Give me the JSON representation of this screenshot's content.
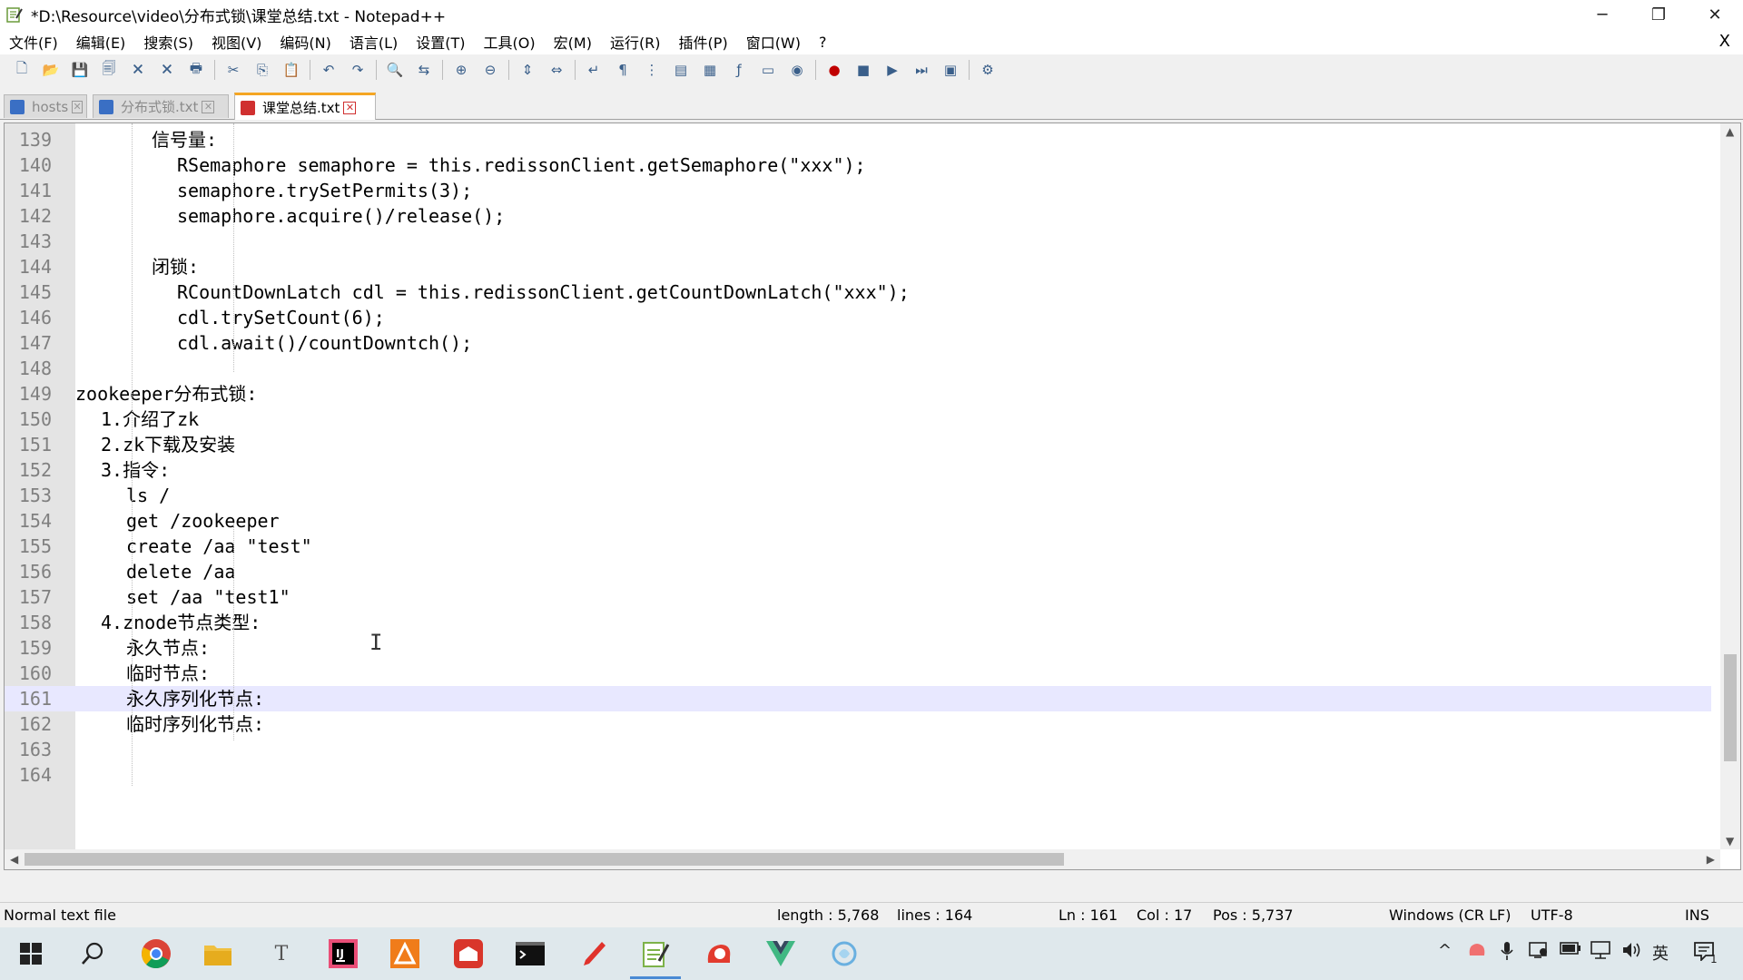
{
  "window": {
    "title": "*D:\\Resource\\video\\分布式锁\\课堂总结.txt - Notepad++",
    "controls": {
      "minimize": "─",
      "maximize": "❐",
      "close": "✕"
    }
  },
  "menu": {
    "items": [
      "文件(F)",
      "编辑(E)",
      "搜索(S)",
      "视图(V)",
      "编码(N)",
      "语言(L)",
      "设置(T)",
      "工具(O)",
      "宏(M)",
      "运行(R)",
      "插件(P)",
      "窗口(W)",
      "?"
    ],
    "close": "X"
  },
  "toolbar": {
    "icons": [
      "new-file-icon",
      "open-file-icon",
      "save-icon",
      "save-all-icon",
      "close-icon",
      "close-all-icon",
      "print-icon",
      "cut-icon",
      "copy-icon",
      "paste-icon",
      "undo-icon",
      "redo-icon",
      "find-icon",
      "replace-icon",
      "zoom-in-icon",
      "zoom-out-icon",
      "sync-vertical-icon",
      "sync-horizontal-icon",
      "word-wrap-icon",
      "show-all-chars-icon",
      "indent-guide-icon",
      "udl-icon",
      "doc-map-icon",
      "function-list-icon",
      "folder-workspace-icon",
      "monitor-icon",
      "record-macro-icon",
      "stop-macro-icon",
      "play-macro-icon",
      "run-macro-multiple-icon",
      "save-macro-icon",
      "plugin-icon"
    ]
  },
  "tabs": [
    {
      "label": "hosts",
      "active": false,
      "color": "#3a6fc4"
    },
    {
      "label": "分布式锁.txt",
      "active": false,
      "color": "#3a6fc4"
    },
    {
      "label": "课堂总结.txt",
      "active": true,
      "color": "#d03030"
    }
  ],
  "editor": {
    "current_line": 161,
    "lines": [
      {
        "n": "139",
        "indent": 6,
        "text": "信号量:"
      },
      {
        "n": "140",
        "indent": 8,
        "text": "RSemaphore semaphore = this.redissonClient.getSemaphore(\"xxx\");"
      },
      {
        "n": "141",
        "indent": 8,
        "text": "semaphore.trySetPermits(3);"
      },
      {
        "n": "142",
        "indent": 8,
        "text": "semaphore.acquire()/release();"
      },
      {
        "n": "143",
        "indent": 0,
        "text": ""
      },
      {
        "n": "144",
        "indent": 6,
        "text": "闭锁:"
      },
      {
        "n": "145",
        "indent": 8,
        "text": "RCountDownLatch cdl = this.redissonClient.getCountDownLatch(\"xxx\");"
      },
      {
        "n": "146",
        "indent": 8,
        "text": "cdl.trySetCount(6);"
      },
      {
        "n": "147",
        "indent": 8,
        "text": "cdl.await()/countDowntch();"
      },
      {
        "n": "148",
        "indent": 0,
        "text": ""
      },
      {
        "n": "149",
        "indent": 0,
        "text": "zookeeper分布式锁:"
      },
      {
        "n": "150",
        "indent": 2,
        "text": "1.介绍了zk"
      },
      {
        "n": "151",
        "indent": 2,
        "text": "2.zk下载及安装"
      },
      {
        "n": "152",
        "indent": 2,
        "text": "3.指令:"
      },
      {
        "n": "153",
        "indent": 4,
        "text": "ls /"
      },
      {
        "n": "154",
        "indent": 4,
        "text": "get /zookeeper"
      },
      {
        "n": "155",
        "indent": 4,
        "text": "create /aa \"test\""
      },
      {
        "n": "156",
        "indent": 4,
        "text": "delete /aa"
      },
      {
        "n": "157",
        "indent": 4,
        "text": "set /aa \"test1\""
      },
      {
        "n": "158",
        "indent": 2,
        "text": "4.znode节点类型:"
      },
      {
        "n": "159",
        "indent": 4,
        "text": "永久节点:"
      },
      {
        "n": "160",
        "indent": 4,
        "text": "临时节点:"
      },
      {
        "n": "161",
        "indent": 4,
        "text": "永久序列化节点:"
      },
      {
        "n": "162",
        "indent": 4,
        "text": "临时序列化节点:"
      },
      {
        "n": "163",
        "indent": 0,
        "text": ""
      },
      {
        "n": "164",
        "indent": 0,
        "text": ""
      }
    ]
  },
  "statusbar": {
    "file_type": "Normal text file",
    "length": "length : 5,768",
    "lines": "lines : 164",
    "ln": "Ln : 161",
    "col": "Col : 17",
    "pos": "Pos : 5,737",
    "eol": "Windows (CR LF)",
    "encoding": "UTF-8",
    "mode": "INS"
  },
  "taskbar": {
    "apps": [
      "start-icon",
      "search-icon",
      "chrome-icon",
      "file-explorer-icon",
      "typora-icon",
      "intellij-icon",
      "office-icon",
      "foxmail-icon",
      "terminal-icon",
      "pen-icon",
      "notepadpp-icon",
      "snail-icon",
      "vuejs-icon",
      "feather-icon"
    ],
    "tray": {
      "chevron": "^",
      "ime": "英",
      "notif_count": "1"
    }
  }
}
